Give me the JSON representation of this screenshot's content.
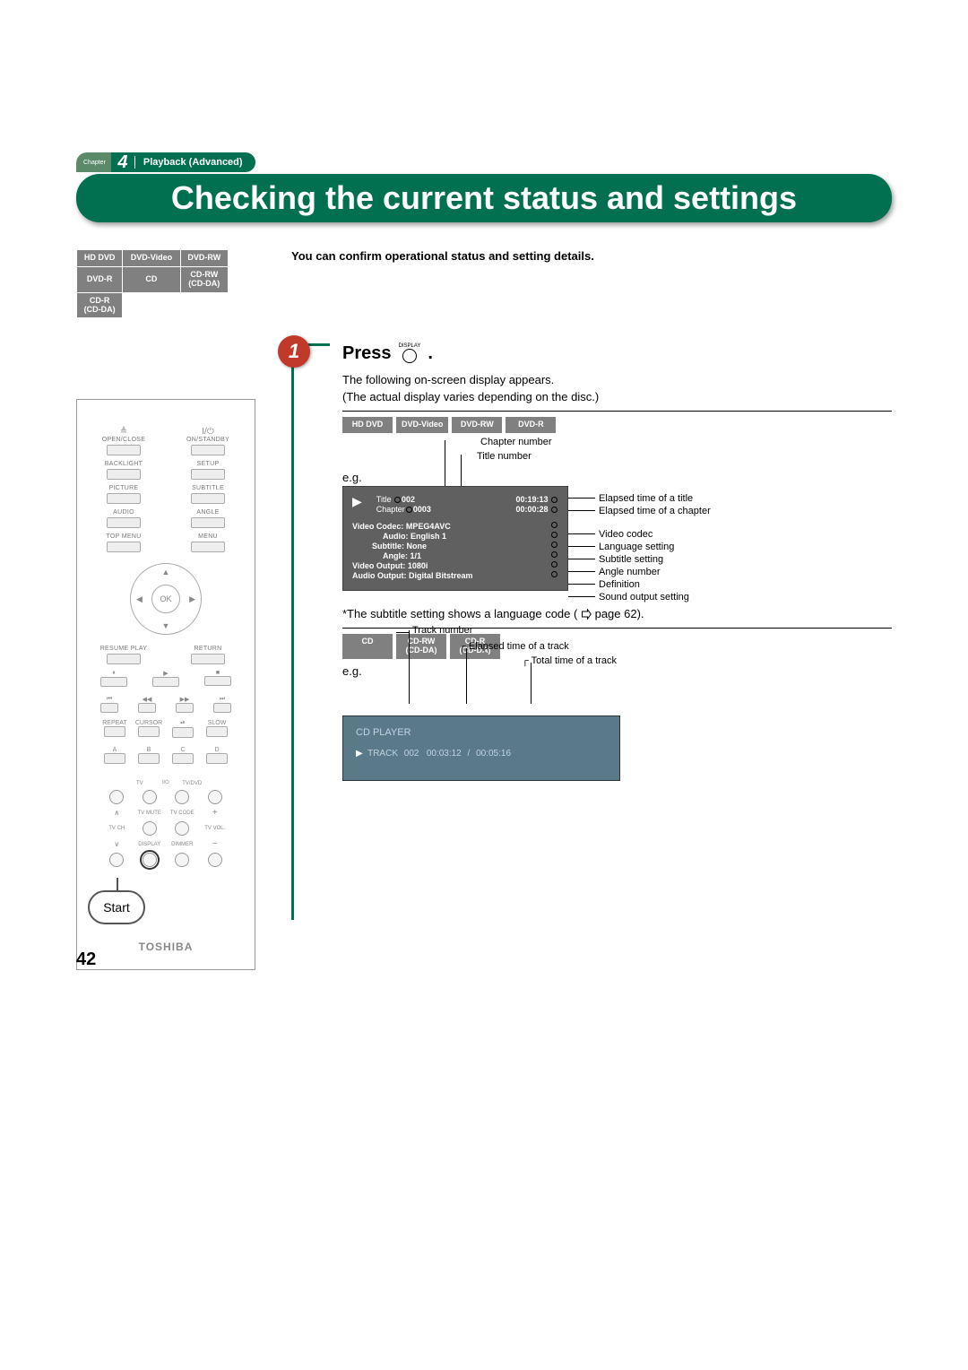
{
  "chapter": {
    "label": "Chapter",
    "number": "4",
    "section": "Playback (Advanced)"
  },
  "title": "Checking the current status and settings",
  "disc_types": {
    "r1c1": "HD DVD",
    "r1c2": "DVD-Video",
    "r1c3": "DVD-RW",
    "r2c1": "DVD-R",
    "r2c2": "CD",
    "r2c3": "CD-RW\n(CD-DA)",
    "r3c1": "CD-R\n(CD-DA)"
  },
  "intro": "You can confirm operational status and setting details.",
  "remote": {
    "open_close": "OPEN/CLOSE",
    "on_standby": "ON/STANDBY",
    "backlight": "BACKLIGHT",
    "setup": "SETUP",
    "picture": "PICTURE",
    "subtitle": "SUBTITLE",
    "audio": "AUDIO",
    "angle": "ANGLE",
    "top_menu": "TOP MENU",
    "menu": "MENU",
    "ok": "OK",
    "resume_play": "RESUME PLAY",
    "return": "RETURN",
    "repeat": "REPEAT",
    "cursor": "CURSOR",
    "slow": "SLOW",
    "a": "A",
    "b": "B",
    "c": "C",
    "d": "D",
    "tv": "TV",
    "power": "I/⏻",
    "tvdvd": "TV/DVD",
    "tv_ch": "TV CH",
    "tv_mute": "TV MUTE",
    "tv_code": "TV CODE",
    "tv_vol": "TV VOL.",
    "display": "DISPLAY",
    "dimmer": "DIMMER",
    "start": "Start",
    "brand": "TOSHIBA"
  },
  "step": {
    "num": "1",
    "press": "Press",
    "press_btn": "DISPLAY",
    "dot": ".",
    "line1": "The following on-screen display appears.",
    "line2": "(The actual display varies depending on the disc.)"
  },
  "tags1": {
    "t1": "HD DVD",
    "t2": "DVD-Video",
    "t3": "DVD-RW",
    "t4": "DVD-R"
  },
  "callouts_top": {
    "chapter_num": "Chapter number",
    "title_num": "Title number"
  },
  "eg": "e.g.",
  "osd1": {
    "title_lbl": "Title",
    "title_val": "002",
    "title_time": "00:19:13",
    "chapter_lbl": "Chapter",
    "chapter_val": "0003",
    "chapter_time": "00:00:28",
    "video_codec_lbl": "Video Codec:",
    "video_codec_val": "MPEG4AVC",
    "audio_lbl": "Audio:",
    "audio_val": "English 1",
    "subtitle_lbl": "Subtitle:",
    "subtitle_val": "None",
    "angle_lbl": "Angle:",
    "angle_val": "1/1",
    "video_out_lbl": "Video Output:",
    "video_out_val": "1080i",
    "audio_out_lbl": "Audio Output:",
    "audio_out_val": "Digital Bitstream"
  },
  "callouts1": {
    "c1": "Elapsed time of a title",
    "c2": "Elapsed time of a chapter",
    "c3": "Video codec",
    "c4": "Language setting",
    "c5": "Subtitle setting",
    "c6": "Angle number",
    "c7": "Definition",
    "c8": "Sound output setting"
  },
  "footnote": "*The subtitle setting shows a language code (",
  "footnote_page": " page 62).",
  "tags2": {
    "t1": "CD",
    "t2": "CD-RW\n(CD-DA)",
    "t3": "CD-R\n(CD-DA)"
  },
  "callouts_cd_top": {
    "track_num": "Track number",
    "elapsed": "Elapsed time of a track",
    "total": "Total time of a track"
  },
  "osd2": {
    "header": "CD PLAYER",
    "track_lbl": "TRACK",
    "track_val": "002",
    "elapsed": "00:03:12",
    "sep": "/",
    "total": "00:05:16"
  },
  "page_number": "42"
}
